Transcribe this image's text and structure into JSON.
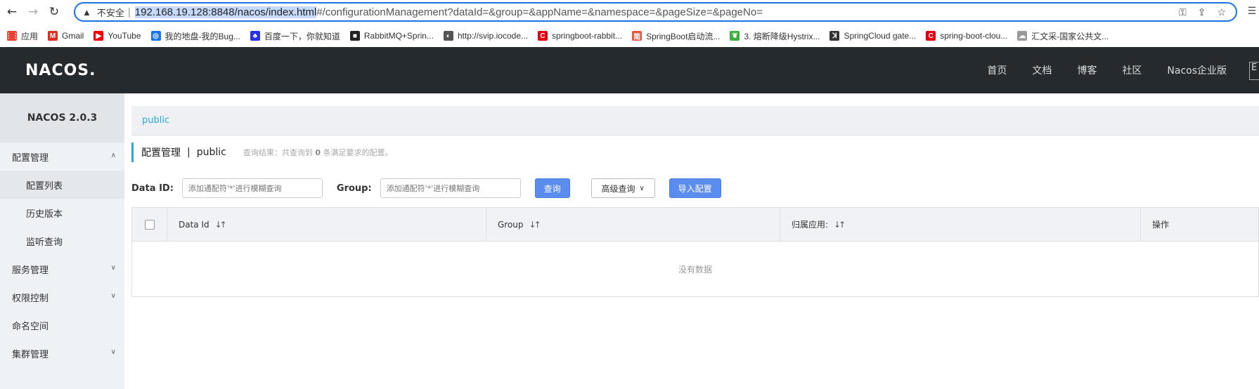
{
  "browser": {
    "insecure_label": "不安全",
    "url_host": "192.168.19.128:8848/nacos/index.html",
    "url_rest": "#/configurationManagement?dataId=&group=&appName=&namespace=&pageSize=&pageNo=",
    "bookmarks": [
      {
        "label": "应用",
        "icon": "apps-grid-icon",
        "color": "#e94235"
      },
      {
        "label": "Gmail",
        "icon": "gmail-icon",
        "color": "#d93025"
      },
      {
        "label": "YouTube",
        "icon": "youtube-icon",
        "color": "#ff0000"
      },
      {
        "label": "我的地盘-我的Bug...",
        "icon": "bug-site-icon",
        "color": "#1a73e8"
      },
      {
        "label": "百度一下，你就知道",
        "icon": "baidu-icon",
        "color": "#2932e1"
      },
      {
        "label": "RabbitMQ+Sprin...",
        "icon": "rabbitmq-icon",
        "color": "#222222"
      },
      {
        "label": "http://svip.iocode...",
        "icon": "globe-icon",
        "color": "#555555"
      },
      {
        "label": "springboot-rabbit...",
        "icon": "csdn-icon",
        "color": "#e60012"
      },
      {
        "label": "SpringBoot启动流...",
        "icon": "jianshu-icon",
        "color": "#e9573f"
      },
      {
        "label": "3. 熔断降级Hystrix...",
        "icon": "leaf-icon",
        "color": "#3cb043"
      },
      {
        "label": "SpringCloud gate...",
        "icon": "gate-icon",
        "color": "#333333"
      },
      {
        "label": "spring-boot-clou...",
        "icon": "csdn-icon",
        "color": "#e60012"
      },
      {
        "label": "汇文采-国家公共文...",
        "icon": "cloud-icon",
        "color": "#999999"
      }
    ]
  },
  "header": {
    "logo": "NACOS.",
    "nav": [
      "首页",
      "文档",
      "博客",
      "社区",
      "Nacos企业版"
    ],
    "lang": "E"
  },
  "sidebar": {
    "version": "NACOS 2.0.3",
    "items": [
      {
        "label": "配置管理",
        "sub": false,
        "chevron": "up"
      },
      {
        "label": "配置列表",
        "sub": true,
        "active": true
      },
      {
        "label": "历史版本",
        "sub": true
      },
      {
        "label": "监听查询",
        "sub": true
      },
      {
        "label": "服务管理",
        "sub": false,
        "chevron": "down"
      },
      {
        "label": "权限控制",
        "sub": false,
        "chevron": "down"
      },
      {
        "label": "命名空间",
        "sub": false
      },
      {
        "label": "集群管理",
        "sub": false,
        "chevron": "down"
      }
    ]
  },
  "main": {
    "namespace_tab": "public",
    "title": "配置管理",
    "title_ns": "public",
    "hint_prefix": "查询结果：共查询到",
    "hint_count": "0",
    "hint_suffix": "条满足要求的配置。",
    "filter": {
      "dataid_label": "Data ID:",
      "dataid_placeholder": "添加通配符'*'进行模糊查询",
      "group_label": "Group:",
      "group_placeholder": "添加通配符'*'进行模糊查询",
      "query_button": "查询",
      "advanced_button": "高级查询",
      "import_button": "导入配置"
    },
    "table": {
      "columns": [
        "Data Id",
        "Group",
        "归属应用:",
        "操作"
      ],
      "empty_text": "没有数据"
    }
  },
  "colors": {
    "accent": "#2aa8e0",
    "primary_button": "#5b8def",
    "topbar": "#252a2f",
    "sidebar": "#eef1f5"
  }
}
